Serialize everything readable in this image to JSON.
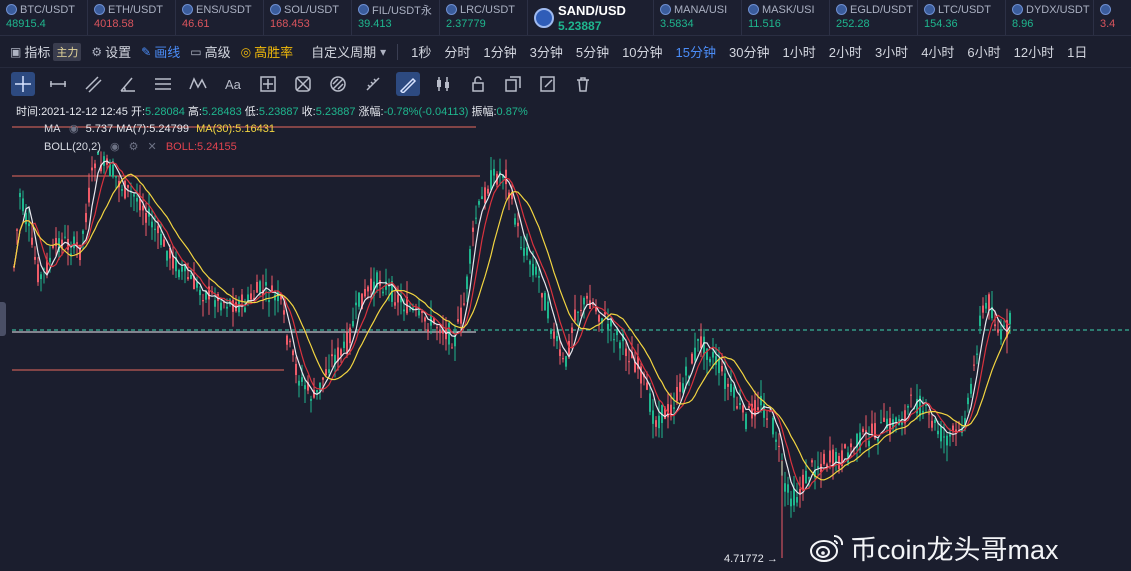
{
  "tickers": [
    {
      "symbol": "BTC/USDT",
      "price": "48915.4",
      "dir": "up"
    },
    {
      "symbol": "ETH/USDT",
      "price": "4018.58",
      "dir": "down"
    },
    {
      "symbol": "ENS/USDT",
      "price": "46.61",
      "dir": "down"
    },
    {
      "symbol": "SOL/USDT",
      "price": "168.453",
      "dir": "down"
    },
    {
      "symbol": "FIL/USDT永",
      "price": "39.413",
      "dir": "up"
    },
    {
      "symbol": "LRC/USDT",
      "price": "2.37779",
      "dir": "up"
    },
    {
      "symbol": "SAND/USD",
      "price": "5.23887",
      "dir": "up",
      "active": true
    },
    {
      "symbol": "MANA/USI",
      "price": "3.5834",
      "dir": "up"
    },
    {
      "symbol": "MASK/USI",
      "price": "11.516",
      "dir": "up"
    },
    {
      "symbol": "EGLD/USDT",
      "price": "252.28",
      "dir": "up"
    },
    {
      "symbol": "LTC/USDT",
      "price": "154.36",
      "dir": "up"
    },
    {
      "symbol": "DYDX/USDT",
      "price": "8.96",
      "dir": "up"
    },
    {
      "symbol": "",
      "price": "3.4",
      "dir": "down"
    }
  ],
  "menu": {
    "indicator": "指标",
    "indicator_badge": "主力",
    "settings": "设置",
    "draw": "画线",
    "advanced": "高级",
    "winrate": "高胜率",
    "custom_period": "自定义周期",
    "timeframes": [
      "1秒",
      "分时",
      "1分钟",
      "3分钟",
      "5分钟",
      "10分钟",
      "15分钟",
      "30分钟",
      "1小时",
      "2小时",
      "3小时",
      "4小时",
      "6小时",
      "12小时",
      "1日"
    ],
    "selected_timeframe": "15分钟"
  },
  "tools": [
    "crosshair",
    "horizontal-line",
    "trend-lines",
    "angle",
    "parallel-channel",
    "wave-pattern",
    "text",
    "measure",
    "fibonacci",
    "gann",
    "ruler",
    "brush",
    "candlestick",
    "lock",
    "copy",
    "edit",
    "trash"
  ],
  "info": {
    "time_label": "时间:",
    "time": "2021-12-12 12:45",
    "open_label": "开:",
    "open": "5.28084",
    "high_label": "高:",
    "high": "5.28483",
    "low_label": "低:",
    "low": "5.23887",
    "close_label": "收:",
    "close": "5.23887",
    "change_label": "涨幅:",
    "change": "-0.78%(-0.04113)",
    "amplitude_label": "振幅:",
    "amplitude": "0.87%"
  },
  "indicators": {
    "ma_label": "MA",
    "ma7": "MA(7):5.24799",
    "ma7_prefix": "5.737",
    "ma30": "MA(30):5.16431",
    "boll_label": "BOLL(20,2)",
    "boll_value": "BOLL:5.24155"
  },
  "chart": {
    "low_marker": "4.71772 →",
    "colors": {
      "up": "#1fb68e",
      "down": "#ef5b68",
      "ma7": "#e8e8ee",
      "ma30": "#f2d541",
      "boll": "#d9323e",
      "current": "#3fd7b0"
    }
  },
  "watermark": "币coin龙头哥max"
}
